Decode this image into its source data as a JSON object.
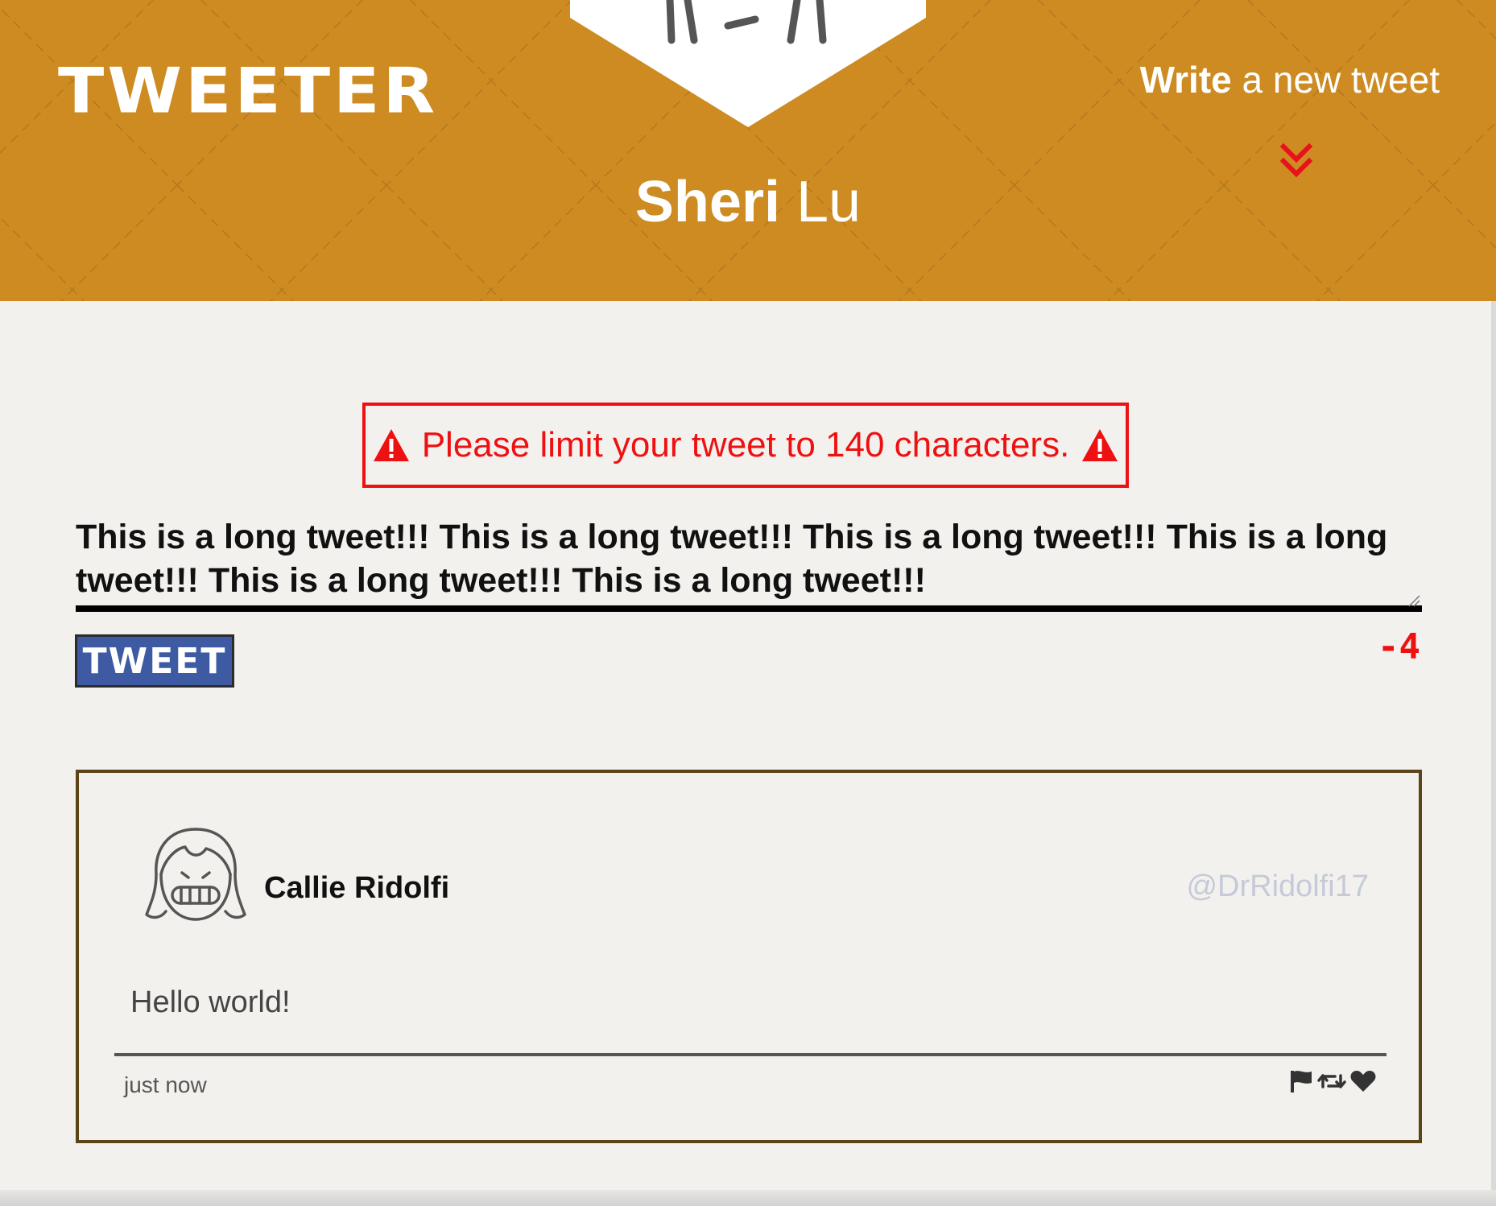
{
  "nav": {
    "brand": "TWEETER",
    "compose_toggle_strong": "Write",
    "compose_toggle_rest": " a new tweet",
    "chevron_icon": "double-chevron-down-icon",
    "avatar_icon": "profile-avatar-icon",
    "background_color": "#cd8b22"
  },
  "profile": {
    "first_name": "Sheri",
    "last_name": "Lu"
  },
  "composer": {
    "error_message": "Please limit your tweet to 140 characters.",
    "warning_icon": "warning-triangle-icon",
    "input_value": "This is a long tweet!!! This is a long tweet!!! This is a long tweet!!! This is a long tweet!!! This is a long tweet!!! This is a long tweet!!!",
    "button_label": "TWEET",
    "counter": "-4",
    "error_color": "#ee1111",
    "button_color": "#3d5aa3"
  },
  "tweets": [
    {
      "author_name": "Callie Ridolfi",
      "handle": "@DrRidolfi17",
      "body": "Hello world!",
      "timestamp": "just now",
      "avatar_icon": "girl-avatar-icon",
      "actions": [
        "flag-icon",
        "retweet-icon",
        "heart-icon"
      ]
    }
  ]
}
